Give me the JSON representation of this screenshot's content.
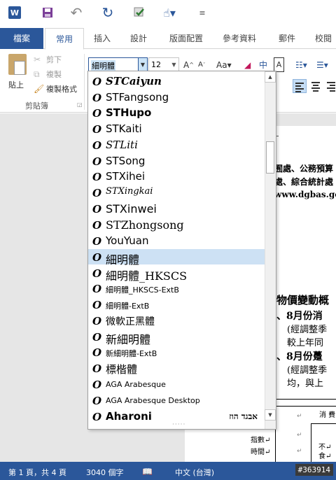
{
  "quick_access": {
    "app_icon": "W"
  },
  "tabs": [
    {
      "label": "檔案"
    },
    {
      "label": "常用"
    },
    {
      "label": "插入"
    },
    {
      "label": "設計"
    },
    {
      "label": "版面配置"
    },
    {
      "label": "參考資料"
    },
    {
      "label": "郵件"
    },
    {
      "label": "校閱"
    }
  ],
  "clipboard": {
    "paste_label": "貼上",
    "cut_label": "剪下",
    "copy_label": "複製",
    "painter_label": "複製格式",
    "group_label": "剪貼簿"
  },
  "font_group": {
    "font_name": "細明體",
    "font_size": "12",
    "grow_label": "A",
    "shrink_label": "A",
    "case_label": "Aa",
    "phonetic_label": "中",
    "border_label": "A"
  },
  "font_list": [
    {
      "name": "STCaiyun",
      "preview": ""
    },
    {
      "name": "STFangsong",
      "preview": ""
    },
    {
      "name": "STHupo",
      "preview": ""
    },
    {
      "name": "STKaiti",
      "preview": ""
    },
    {
      "name": "STLiti",
      "preview": ""
    },
    {
      "name": "STSong",
      "preview": ""
    },
    {
      "name": "STXihei",
      "preview": ""
    },
    {
      "name": "STXingkai",
      "preview": ""
    },
    {
      "name": "STXinwei",
      "preview": ""
    },
    {
      "name": "STZhongsong",
      "preview": ""
    },
    {
      "name": "YouYuan",
      "preview": ""
    },
    {
      "name": "細明體",
      "preview": ""
    },
    {
      "name": "細明體_HKSCS",
      "preview": ""
    },
    {
      "name": "細明體_HKSCS-ExtB",
      "preview": ""
    },
    {
      "name": "細明體-ExtB",
      "preview": ""
    },
    {
      "name": "微軟正黑體",
      "preview": ""
    },
    {
      "name": "新細明體",
      "preview": ""
    },
    {
      "name": "新細明體-ExtB",
      "preview": ""
    },
    {
      "name": "標楷體",
      "preview": ""
    },
    {
      "name": "AGA Arabesque",
      "preview": ""
    },
    {
      "name": "AGA Arabesque Desktop",
      "preview": ""
    },
    {
      "name": "Aharoni",
      "preview": "אבגד הוז"
    }
  ],
  "document": {
    "line1": "囿處、公務預算",
    "line2": "處、綜合統計處",
    "line3": "www.dgbas.gov",
    "line4": "物價變動概",
    "line5": "、8月份消",
    "line6": "(經調整季",
    "line7": "較上年同",
    "line8": "、8月份躉",
    "line9": "(經調整季",
    "line10": "均，與上",
    "table_header": "消 費 者",
    "row_label1": "指數↵",
    "row_label2": "時間↵",
    "cell1": "不↵",
    "cell2": "食↵"
  },
  "status": {
    "page": "第 1 頁，共 4 頁",
    "words": "3040 個字",
    "language": "中文 (台灣)",
    "watermark": "#363914"
  },
  "colors": {
    "accent": "#2b579a",
    "selection": "#cde1f4"
  }
}
